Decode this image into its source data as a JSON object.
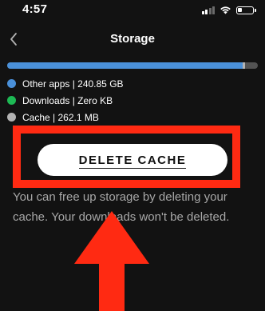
{
  "status_bar": {
    "time": "4:57",
    "icons": [
      "signal-icon",
      "wifi-icon",
      "battery-icon"
    ]
  },
  "nav": {
    "title": "Storage",
    "back_icon": "chevron-left-icon"
  },
  "storage_bar": {
    "segments": [
      {
        "name": "other_apps",
        "fraction": 0.94,
        "color": "#4a90d9"
      },
      {
        "name": "downloads",
        "fraction": 0.0,
        "color": "#1db954"
      },
      {
        "name": "cache",
        "fraction": 0.01,
        "color": "#b3b3b3"
      }
    ],
    "track_color": "#535353"
  },
  "legend": [
    {
      "label": "Other apps | 240.85 GB",
      "color": "#4a90d9"
    },
    {
      "label": "Downloads | Zero KB",
      "color": "#1db954"
    },
    {
      "label": "Cache | 262.1 MB",
      "color": "#b3b3b3"
    }
  ],
  "delete_cache_button": {
    "label": "DELETE CACHE"
  },
  "description": "You can free up storage by deleting your cache. Your downloads won't be deleted.",
  "annotation": {
    "color": "#ff2a12"
  }
}
